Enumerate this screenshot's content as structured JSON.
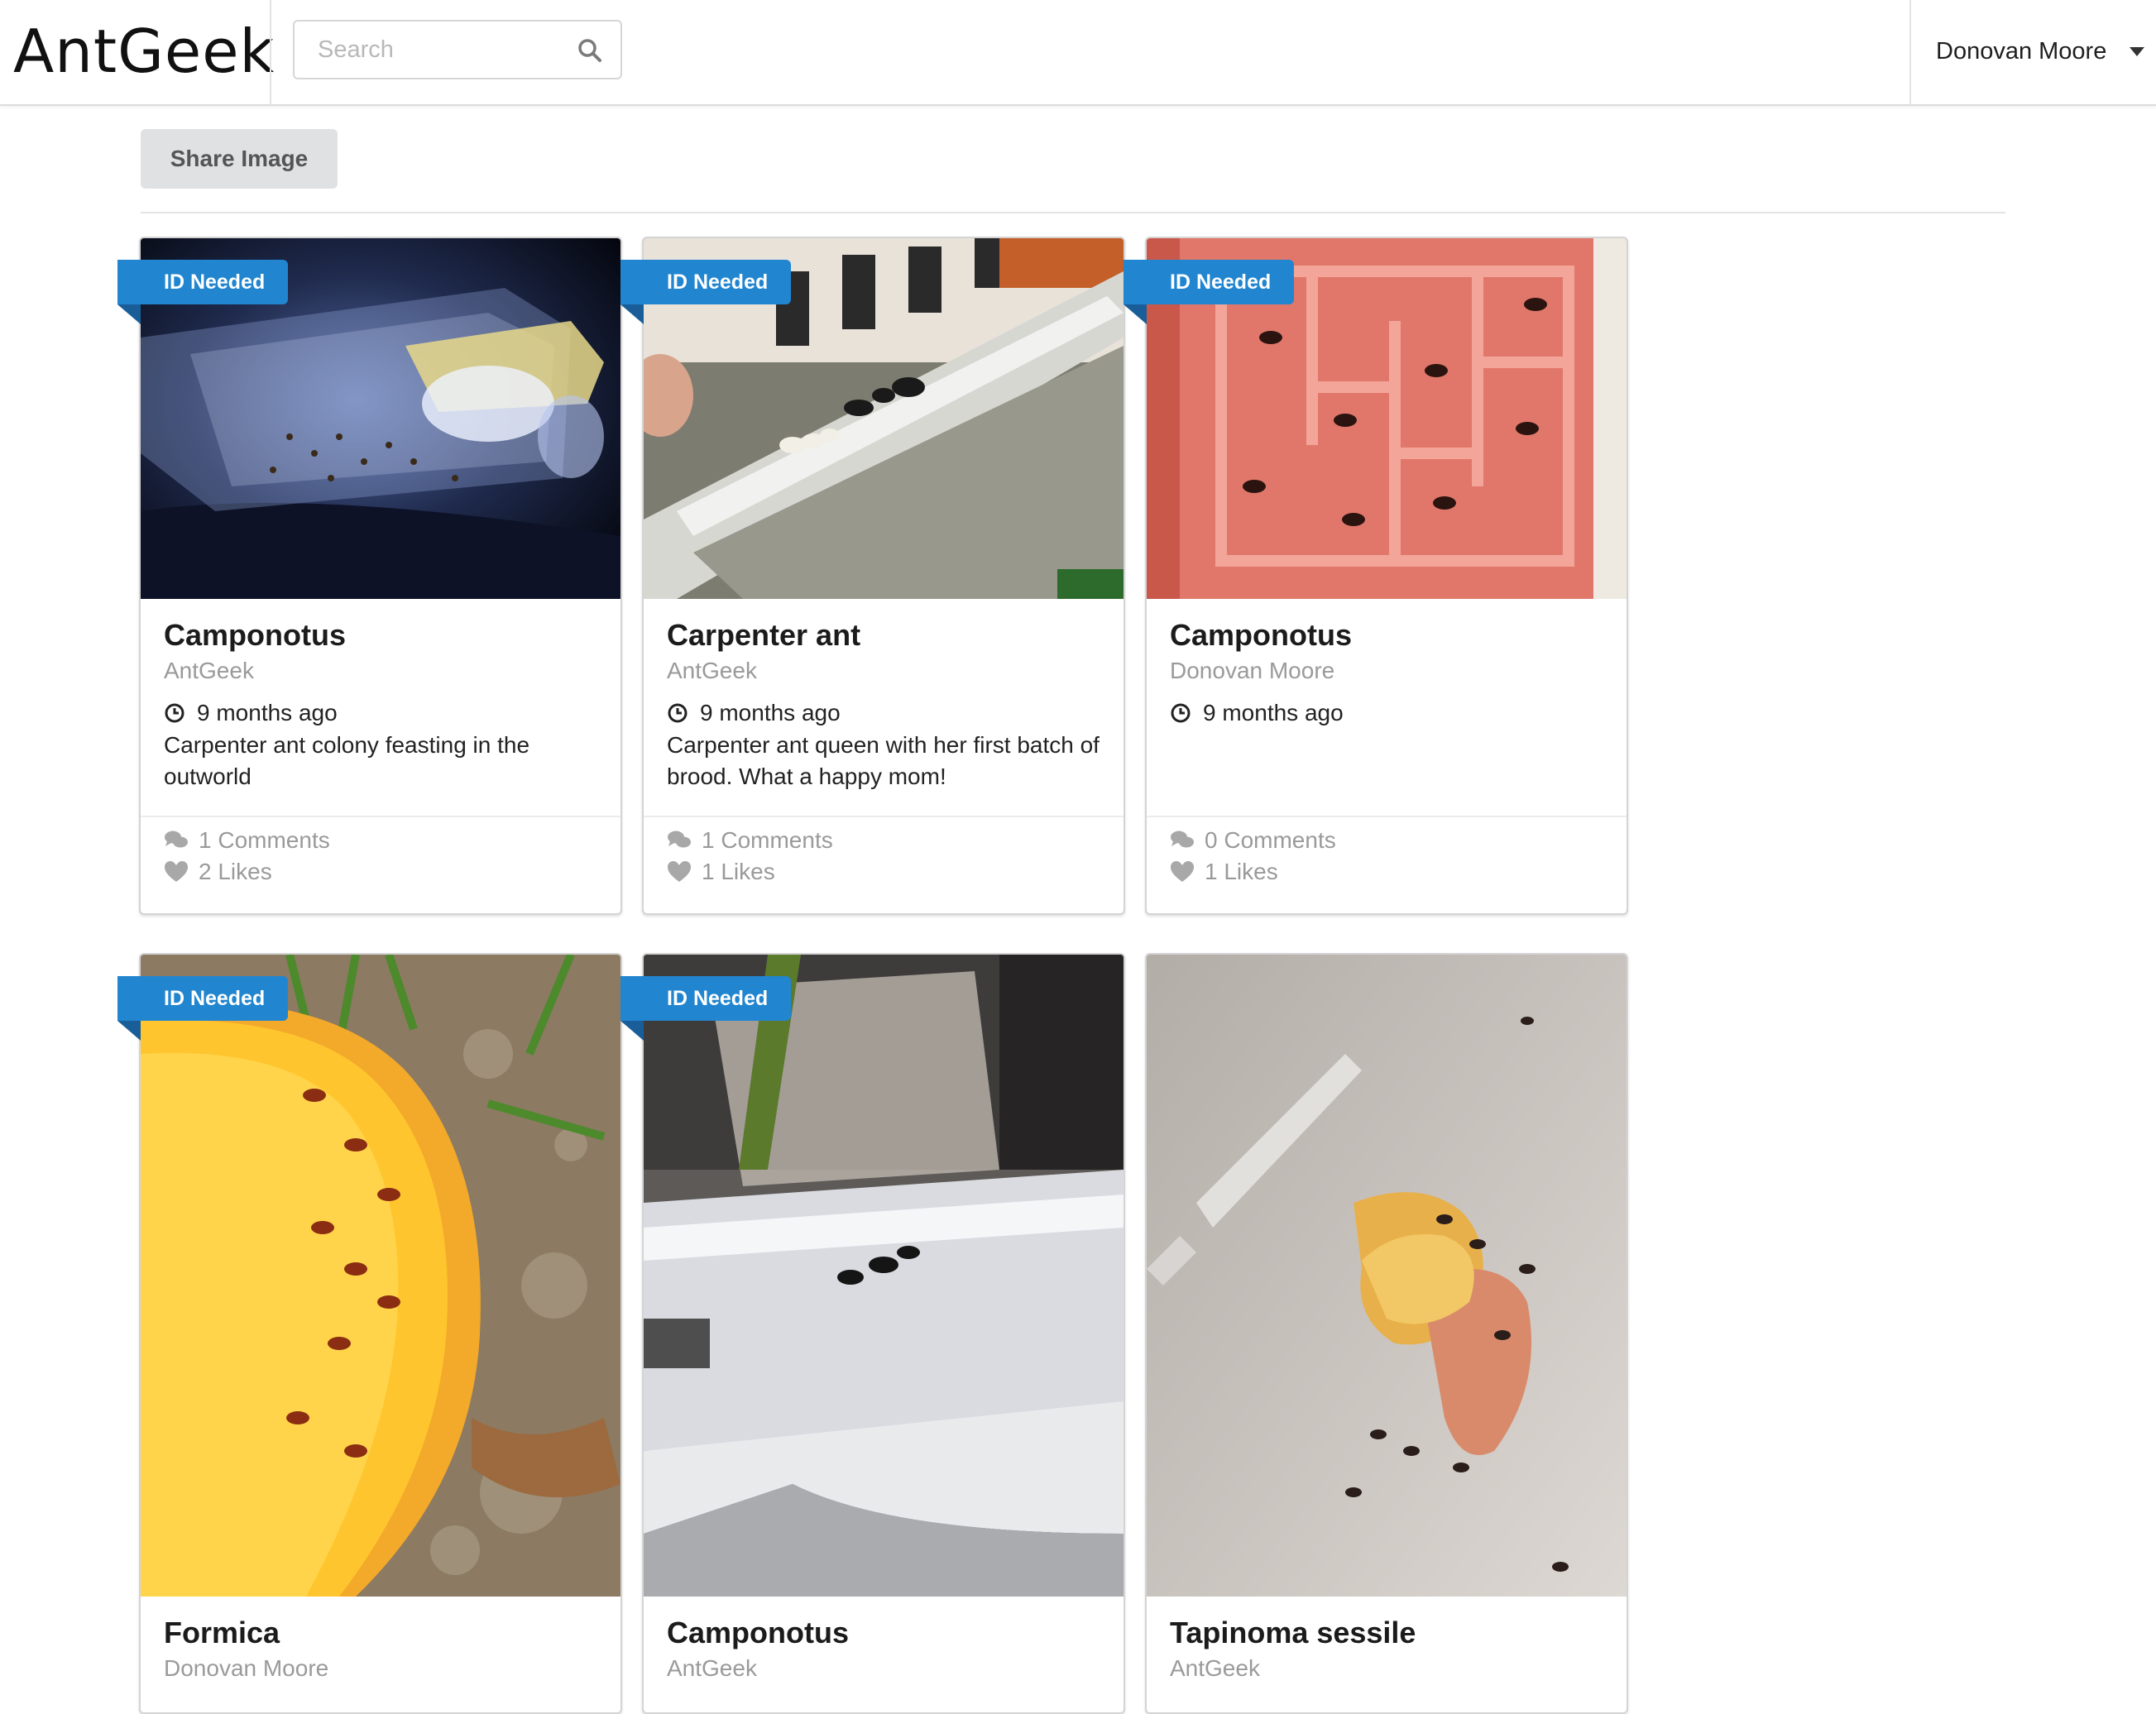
{
  "app": {
    "logo_text": "AntGeek",
    "search": {
      "placeholder": "Search",
      "value": ""
    },
    "user_name": "Donovan Moore"
  },
  "toolbar": {
    "share_label": "Share Image"
  },
  "cards": [
    {
      "badge": "ID Needed",
      "title": "Camponotus",
      "author": "AntGeek",
      "time": "9 months ago",
      "description": "Carpenter ant colony feasting in the outworld",
      "comments": "1 Comments",
      "likes": "2 Likes"
    },
    {
      "badge": "ID Needed",
      "title": "Carpenter ant",
      "author": "AntGeek",
      "time": "9 months ago",
      "description": "Carpenter ant queen with her first batch of brood. What a happy mom!",
      "comments": "1 Comments",
      "likes": "1 Likes"
    },
    {
      "badge": "ID Needed",
      "title": "Camponotus",
      "author": "Donovan Moore",
      "time": "9 months ago",
      "description": "",
      "comments": "0 Comments",
      "likes": "1 Likes"
    },
    {
      "badge": "ID Needed",
      "title": "Formica",
      "author": "Donovan Moore"
    },
    {
      "badge": "ID Needed",
      "title": "Camponotus",
      "author": "AntGeek"
    },
    {
      "badge": "",
      "title": "Tapinoma sessile",
      "author": "AntGeek"
    }
  ],
  "colors": {
    "accent": "#2185d0",
    "muted_text": "#9a9a9a",
    "button_bg": "#e0e1e2"
  },
  "icons": [
    "search-icon",
    "chevron-down-icon",
    "clock-icon",
    "comments-icon",
    "heart-icon"
  ]
}
